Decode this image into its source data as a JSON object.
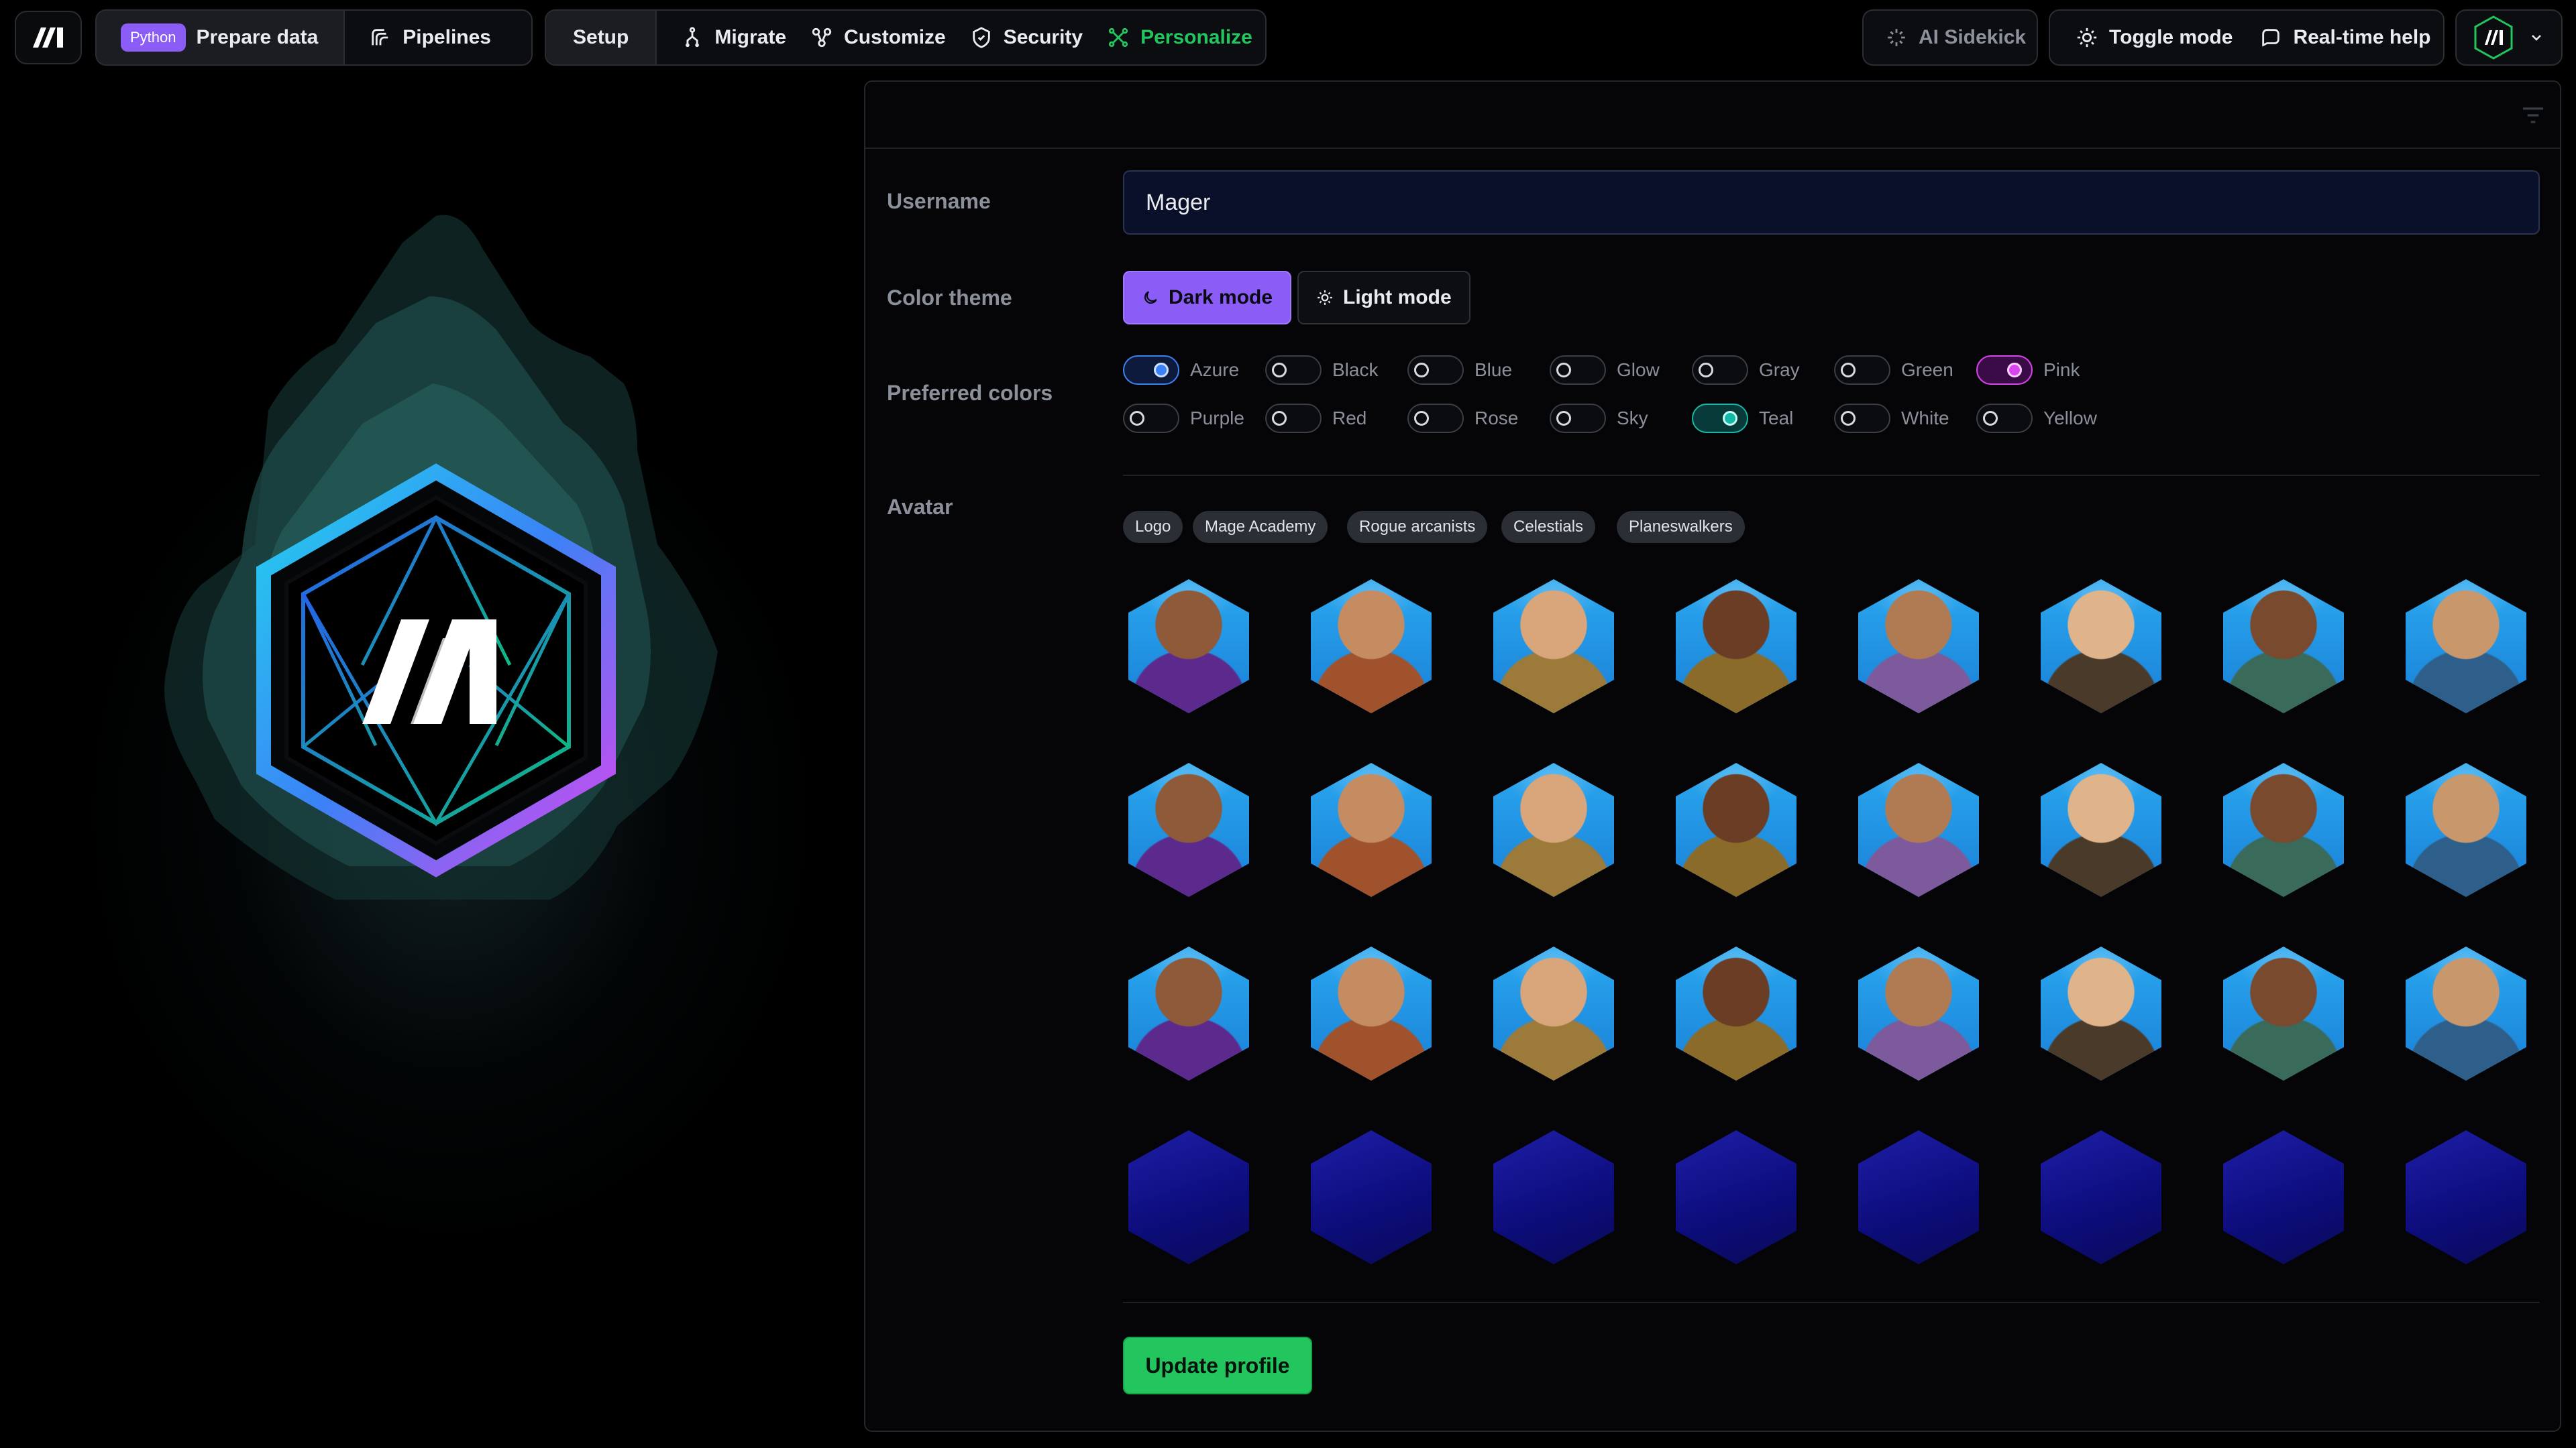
{
  "topbar": {
    "python_badge": "Python",
    "prepare_data": "Prepare data",
    "pipelines": "Pipelines",
    "setup": "Setup",
    "migrate": "Migrate",
    "customize": "Customize",
    "security": "Security",
    "personalize": "Personalize",
    "ai_sidekick": "AI Sidekick",
    "toggle_mode": "Toggle mode",
    "realtime_help": "Real-time help"
  },
  "form": {
    "username_label": "Username",
    "username_value": "Mager",
    "color_theme_label": "Color theme",
    "dark_mode": "Dark mode",
    "light_mode": "Light mode",
    "preferred_colors_label": "Preferred colors",
    "colors": [
      {
        "label": "Azure",
        "state": "on-azure"
      },
      {
        "label": "Black",
        "state": "off"
      },
      {
        "label": "Blue",
        "state": "off"
      },
      {
        "label": "Glow",
        "state": "off"
      },
      {
        "label": "Gray",
        "state": "off"
      },
      {
        "label": "Green",
        "state": "off"
      },
      {
        "label": "Pink",
        "state": "on-pink"
      },
      {
        "label": "Purple",
        "state": "off"
      },
      {
        "label": "Red",
        "state": "off"
      },
      {
        "label": "Rose",
        "state": "off"
      },
      {
        "label": "Sky",
        "state": "off"
      },
      {
        "label": "Teal",
        "state": "on-teal"
      },
      {
        "label": "White",
        "state": "off"
      },
      {
        "label": "Yellow",
        "state": "off"
      }
    ],
    "avatar_label": "Avatar",
    "avatar_tags": [
      "Logo",
      "Mage Academy",
      "Rogue arcanists",
      "Celestials",
      "Planeswalkers"
    ],
    "update_button": "Update profile"
  },
  "colors": {
    "accent_purple": "#8b5cf6",
    "accent_green": "#22c55e",
    "azure": "#3b82f6",
    "teal": "#14b8a6",
    "pink": "#d946ef"
  }
}
